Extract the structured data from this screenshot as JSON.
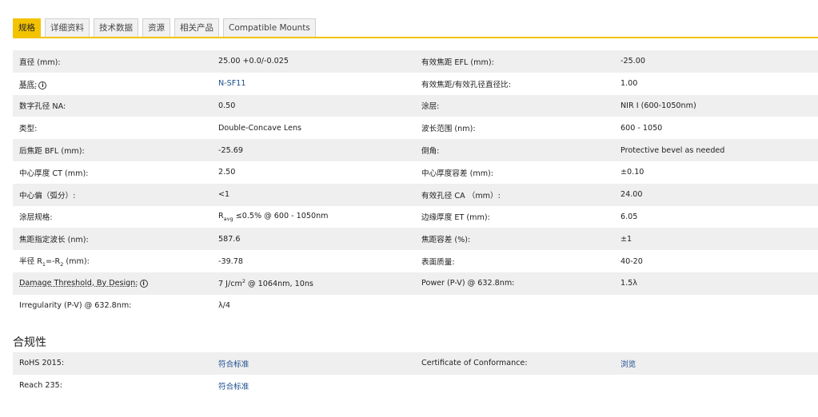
{
  "tabs": [
    {
      "label": "规格",
      "active": true
    },
    {
      "label": "详细资料",
      "active": false
    },
    {
      "label": "技术数据",
      "active": false
    },
    {
      "label": "资源",
      "active": false
    },
    {
      "label": "相关产品",
      "active": false
    },
    {
      "label": "Compatible Mounts",
      "active": false
    }
  ],
  "specs": {
    "r0": {
      "l1": "直径 (mm):",
      "v1": "25.00 +0.0/-0.025",
      "l2": "有效焦距 EFL (mm):",
      "v2": "-25.00"
    },
    "r1": {
      "l1": "基底:",
      "v1": "N-SF11",
      "l2": "有效焦距/有效孔径直径比:",
      "v2": "1.00"
    },
    "r2": {
      "l1": "数字孔径 NA:",
      "v1": "0.50",
      "l2": "涂层:",
      "v2": "NIR I (600-1050nm)"
    },
    "r3": {
      "l1": "类型:",
      "v1": "Double-Concave Lens",
      "l2": "波长范围 (nm):",
      "v2": "600 - 1050"
    },
    "r4": {
      "l1": "后焦距 BFL (mm):",
      "v1": "-25.69",
      "l2": "倒角:",
      "v2": "Protective bevel as needed"
    },
    "r5": {
      "l1": "中心厚度 CT (mm):",
      "v1": "2.50",
      "l2": "中心厚度容差 (mm):",
      "v2": "±0.10"
    },
    "r6": {
      "l1": "中心偏（弧分）:",
      "v1": "<1",
      "l2": "有效孔径 CA （mm）:",
      "v2": "24.00"
    },
    "r7": {
      "l1": "涂层规格:",
      "v1_pre": "R",
      "v1_sub": "avg",
      "v1_post": " ≤0.5% @ 600 - 1050nm",
      "l2": "边缘厚度 ET (mm):",
      "v2": "6.05"
    },
    "r8": {
      "l1": "焦距指定波长 (nm):",
      "v1": "587.6",
      "l2": "焦距容差 (%):",
      "v2": "±1"
    },
    "r9": {
      "l1_pre": "半径 R",
      "l1_sub1": "1",
      "l1_mid": "=-R",
      "l1_sub2": "2",
      "l1_post": " (mm):",
      "v1": "-39.78",
      "l2": "表面质量:",
      "v2": "40-20"
    },
    "r10": {
      "l1": "Damage Threshold, By Design:",
      "v1_pre": "7 J/cm",
      "v1_sup": "2",
      "v1_post": " @ 1064nm, 10ns",
      "l2": "Power (P-V) @ 632.8nm:",
      "v2": "1.5λ"
    },
    "r11": {
      "l1": "Irregularity (P-V) @ 632.8nm:",
      "v1": "λ/4"
    }
  },
  "info_icon_glyph": "i",
  "compliance": {
    "title": "合规性",
    "r0": {
      "l1": "RoHS 2015:",
      "v1": "符合标准",
      "l2": "Certificate of Conformance:",
      "v2": "浏览"
    },
    "r1": {
      "l1": "Reach 235:",
      "v1": "符合标准"
    }
  },
  "colors": {
    "accent": "#f3c300",
    "link": "#1a4d8f",
    "row_shade": "#efefef"
  }
}
